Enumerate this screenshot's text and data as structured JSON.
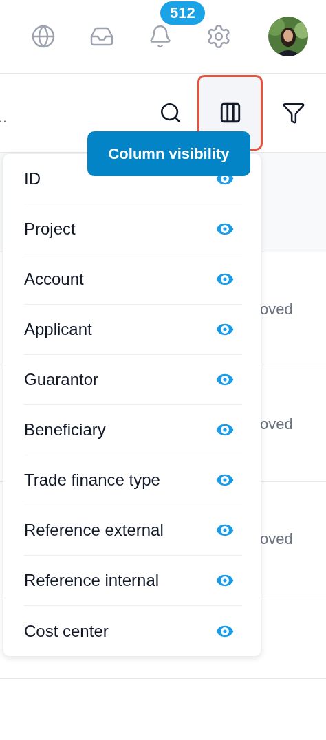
{
  "header": {
    "notification_count": "512"
  },
  "toolbar": {
    "truncated_text": "..",
    "columns_button": {
      "selected": true
    },
    "tooltip": "Column visibility"
  },
  "table": {
    "rows": [
      {
        "kind": "status",
        "status": "oved"
      },
      {
        "kind": "status",
        "status": "oved"
      },
      {
        "kind": "status",
        "status": "oved"
      },
      {
        "kind": "empty"
      }
    ]
  },
  "column_menu": [
    {
      "label": "ID",
      "visible": true
    },
    {
      "label": "Project",
      "visible": true
    },
    {
      "label": "Account",
      "visible": true
    },
    {
      "label": "Applicant",
      "visible": true
    },
    {
      "label": "Guarantor",
      "visible": true
    },
    {
      "label": "Beneficiary",
      "visible": true
    },
    {
      "label": "Trade finance type",
      "visible": true
    },
    {
      "label": "Reference external",
      "visible": true
    },
    {
      "label": "Reference internal",
      "visible": true
    },
    {
      "label": "Cost center",
      "visible": true
    }
  ]
}
